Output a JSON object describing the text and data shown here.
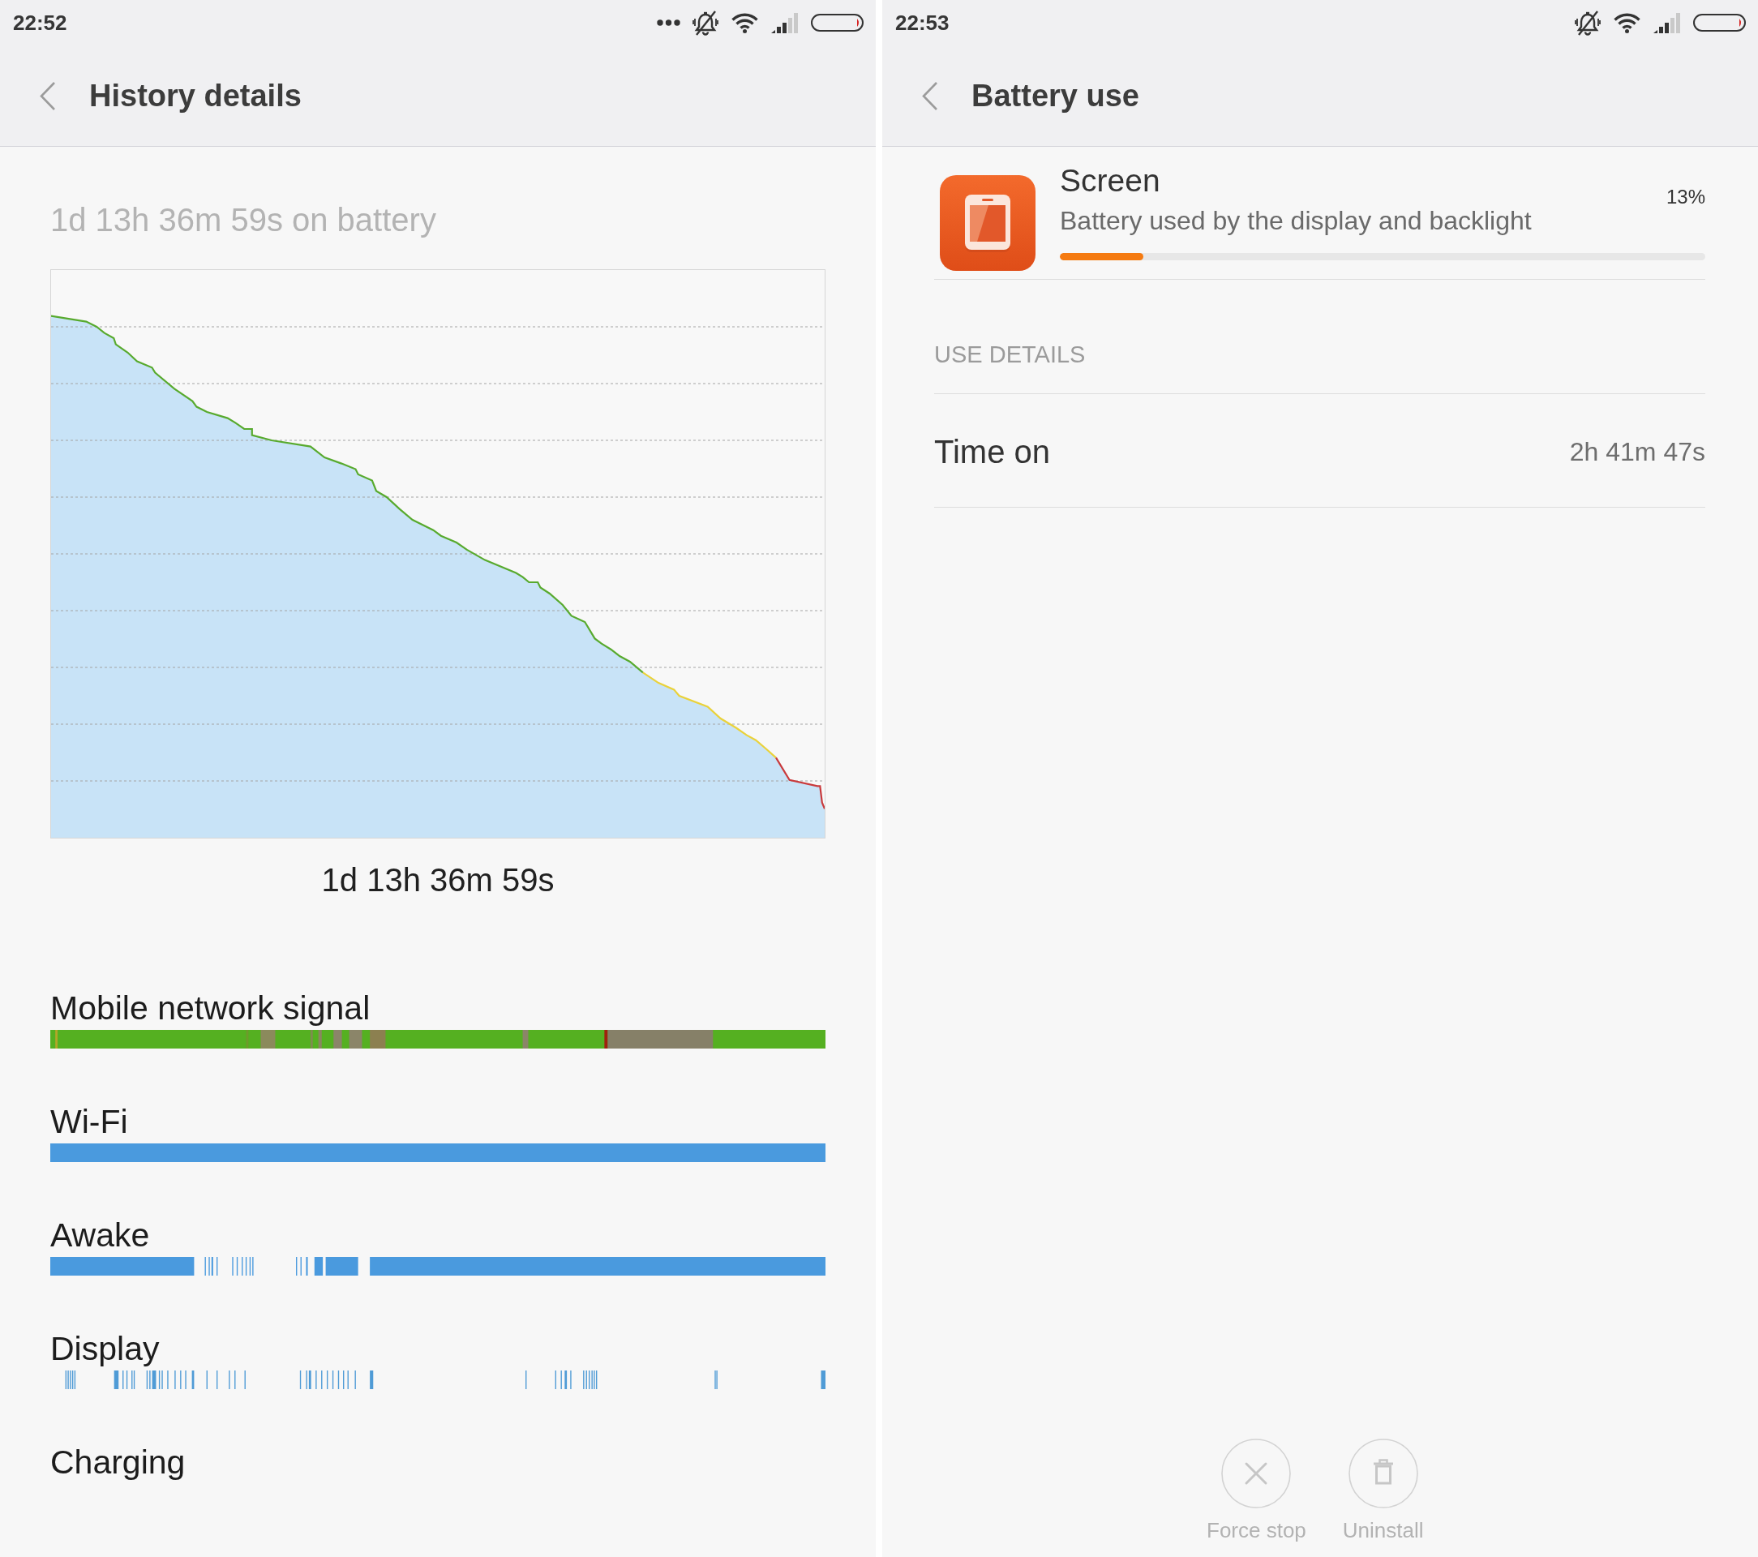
{
  "history_screen": {
    "status_bar": {
      "time": "22:52",
      "notification_overflow": true
    },
    "title": "History details",
    "summary": "1d 13h 36m 59s on battery",
    "chart": {
      "duration_label": "1d 13h 36m 59s"
    },
    "timelines": [
      {
        "label": "Mobile network signal"
      },
      {
        "label": "Wi-Fi"
      },
      {
        "label": "Awake"
      },
      {
        "label": "Display"
      },
      {
        "label": "Charging"
      }
    ]
  },
  "battery_use_screen": {
    "status_bar": {
      "time": "22:53",
      "notification_overflow": false
    },
    "title": "Battery use",
    "app": {
      "name": "Screen",
      "description": "Battery used by the display and backlight",
      "percent": "13%",
      "level": 0.13
    },
    "section_title": "USE DETAILS",
    "details": [
      {
        "label": "Time on",
        "value": "2h 41m 47s"
      }
    ],
    "actions": [
      {
        "kind": "close",
        "label": "Force stop"
      },
      {
        "kind": "trash",
        "label": "Uninstall"
      }
    ]
  }
}
